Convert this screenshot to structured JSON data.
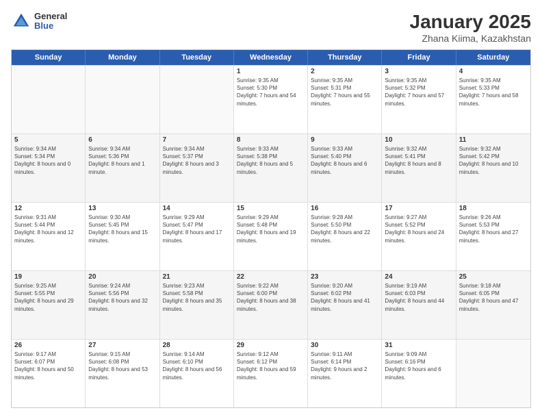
{
  "header": {
    "title": "January 2025",
    "subtitle": "Zhana Kiima, Kazakhstan",
    "logo_general": "General",
    "logo_blue": "Blue"
  },
  "calendar": {
    "weekdays": [
      "Sunday",
      "Monday",
      "Tuesday",
      "Wednesday",
      "Thursday",
      "Friday",
      "Saturday"
    ],
    "rows": [
      [
        {
          "day": "",
          "empty": true
        },
        {
          "day": "",
          "empty": true
        },
        {
          "day": "",
          "empty": true
        },
        {
          "day": "1",
          "sunrise": "Sunrise: 9:35 AM",
          "sunset": "Sunset: 5:30 PM",
          "daylight": "Daylight: 7 hours and 54 minutes."
        },
        {
          "day": "2",
          "sunrise": "Sunrise: 9:35 AM",
          "sunset": "Sunset: 5:31 PM",
          "daylight": "Daylight: 7 hours and 55 minutes."
        },
        {
          "day": "3",
          "sunrise": "Sunrise: 9:35 AM",
          "sunset": "Sunset: 5:32 PM",
          "daylight": "Daylight: 7 hours and 57 minutes."
        },
        {
          "day": "4",
          "sunrise": "Sunrise: 9:35 AM",
          "sunset": "Sunset: 5:33 PM",
          "daylight": "Daylight: 7 hours and 58 minutes."
        }
      ],
      [
        {
          "day": "5",
          "sunrise": "Sunrise: 9:34 AM",
          "sunset": "Sunset: 5:34 PM",
          "daylight": "Daylight: 8 hours and 0 minutes."
        },
        {
          "day": "6",
          "sunrise": "Sunrise: 9:34 AM",
          "sunset": "Sunset: 5:36 PM",
          "daylight": "Daylight: 8 hours and 1 minute."
        },
        {
          "day": "7",
          "sunrise": "Sunrise: 9:34 AM",
          "sunset": "Sunset: 5:37 PM",
          "daylight": "Daylight: 8 hours and 3 minutes."
        },
        {
          "day": "8",
          "sunrise": "Sunrise: 9:33 AM",
          "sunset": "Sunset: 5:38 PM",
          "daylight": "Daylight: 8 hours and 5 minutes."
        },
        {
          "day": "9",
          "sunrise": "Sunrise: 9:33 AM",
          "sunset": "Sunset: 5:40 PM",
          "daylight": "Daylight: 8 hours and 6 minutes."
        },
        {
          "day": "10",
          "sunrise": "Sunrise: 9:32 AM",
          "sunset": "Sunset: 5:41 PM",
          "daylight": "Daylight: 8 hours and 8 minutes."
        },
        {
          "day": "11",
          "sunrise": "Sunrise: 9:32 AM",
          "sunset": "Sunset: 5:42 PM",
          "daylight": "Daylight: 8 hours and 10 minutes."
        }
      ],
      [
        {
          "day": "12",
          "sunrise": "Sunrise: 9:31 AM",
          "sunset": "Sunset: 5:44 PM",
          "daylight": "Daylight: 8 hours and 12 minutes."
        },
        {
          "day": "13",
          "sunrise": "Sunrise: 9:30 AM",
          "sunset": "Sunset: 5:45 PM",
          "daylight": "Daylight: 8 hours and 15 minutes."
        },
        {
          "day": "14",
          "sunrise": "Sunrise: 9:29 AM",
          "sunset": "Sunset: 5:47 PM",
          "daylight": "Daylight: 8 hours and 17 minutes."
        },
        {
          "day": "15",
          "sunrise": "Sunrise: 9:29 AM",
          "sunset": "Sunset: 5:48 PM",
          "daylight": "Daylight: 8 hours and 19 minutes."
        },
        {
          "day": "16",
          "sunrise": "Sunrise: 9:28 AM",
          "sunset": "Sunset: 5:50 PM",
          "daylight": "Daylight: 8 hours and 22 minutes."
        },
        {
          "day": "17",
          "sunrise": "Sunrise: 9:27 AM",
          "sunset": "Sunset: 5:52 PM",
          "daylight": "Daylight: 8 hours and 24 minutes."
        },
        {
          "day": "18",
          "sunrise": "Sunrise: 9:26 AM",
          "sunset": "Sunset: 5:53 PM",
          "daylight": "Daylight: 8 hours and 27 minutes."
        }
      ],
      [
        {
          "day": "19",
          "sunrise": "Sunrise: 9:25 AM",
          "sunset": "Sunset: 5:55 PM",
          "daylight": "Daylight: 8 hours and 29 minutes."
        },
        {
          "day": "20",
          "sunrise": "Sunrise: 9:24 AM",
          "sunset": "Sunset: 5:56 PM",
          "daylight": "Daylight: 8 hours and 32 minutes."
        },
        {
          "day": "21",
          "sunrise": "Sunrise: 9:23 AM",
          "sunset": "Sunset: 5:58 PM",
          "daylight": "Daylight: 8 hours and 35 minutes."
        },
        {
          "day": "22",
          "sunrise": "Sunrise: 9:22 AM",
          "sunset": "Sunset: 6:00 PM",
          "daylight": "Daylight: 8 hours and 38 minutes."
        },
        {
          "day": "23",
          "sunrise": "Sunrise: 9:20 AM",
          "sunset": "Sunset: 6:02 PM",
          "daylight": "Daylight: 8 hours and 41 minutes."
        },
        {
          "day": "24",
          "sunrise": "Sunrise: 9:19 AM",
          "sunset": "Sunset: 6:03 PM",
          "daylight": "Daylight: 8 hours and 44 minutes."
        },
        {
          "day": "25",
          "sunrise": "Sunrise: 9:18 AM",
          "sunset": "Sunset: 6:05 PM",
          "daylight": "Daylight: 8 hours and 47 minutes."
        }
      ],
      [
        {
          "day": "26",
          "sunrise": "Sunrise: 9:17 AM",
          "sunset": "Sunset: 6:07 PM",
          "daylight": "Daylight: 8 hours and 50 minutes."
        },
        {
          "day": "27",
          "sunrise": "Sunrise: 9:15 AM",
          "sunset": "Sunset: 6:08 PM",
          "daylight": "Daylight: 8 hours and 53 minutes."
        },
        {
          "day": "28",
          "sunrise": "Sunrise: 9:14 AM",
          "sunset": "Sunset: 6:10 PM",
          "daylight": "Daylight: 8 hours and 56 minutes."
        },
        {
          "day": "29",
          "sunrise": "Sunrise: 9:12 AM",
          "sunset": "Sunset: 6:12 PM",
          "daylight": "Daylight: 8 hours and 59 minutes."
        },
        {
          "day": "30",
          "sunrise": "Sunrise: 9:11 AM",
          "sunset": "Sunset: 6:14 PM",
          "daylight": "Daylight: 9 hours and 2 minutes."
        },
        {
          "day": "31",
          "sunrise": "Sunrise: 9:09 AM",
          "sunset": "Sunset: 6:16 PM",
          "daylight": "Daylight: 9 hours and 6 minutes."
        },
        {
          "day": "",
          "empty": true
        }
      ]
    ]
  }
}
